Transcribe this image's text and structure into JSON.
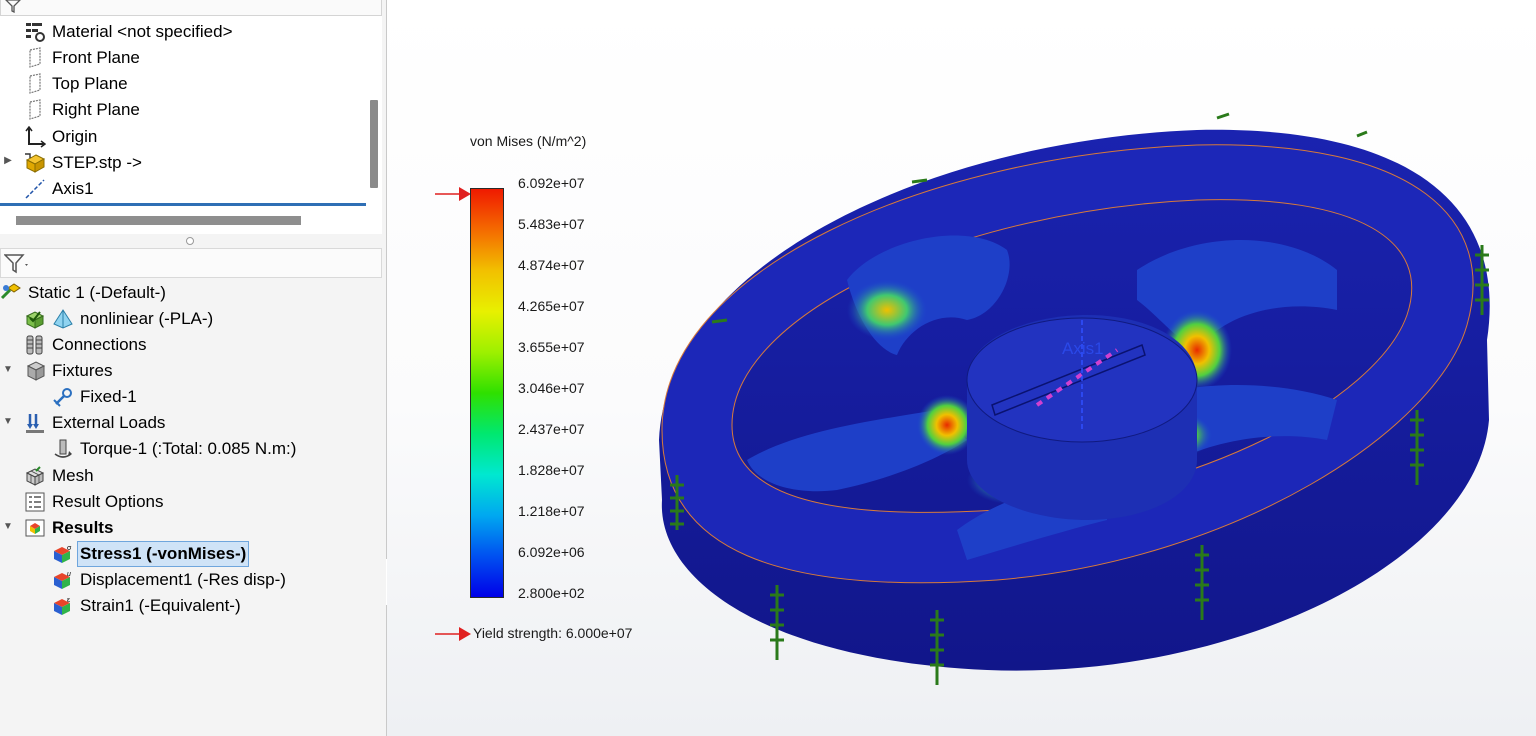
{
  "feature_tree": {
    "items": [
      {
        "label": "Material <not specified>",
        "icon": "material-icon"
      },
      {
        "label": "Front Plane",
        "icon": "plane-icon"
      },
      {
        "label": "Top Plane",
        "icon": "plane-icon"
      },
      {
        "label": "Right Plane",
        "icon": "plane-icon"
      },
      {
        "label": "Origin",
        "icon": "origin-icon"
      },
      {
        "label": "STEP.stp ->",
        "icon": "part-icon"
      },
      {
        "label": "Axis1",
        "icon": "axis-icon"
      }
    ]
  },
  "study_tree": {
    "study": {
      "label": "Static 1 (-Default-)",
      "icon": "study-icon"
    },
    "items": [
      {
        "label": "nonliniear (-PLA-)",
        "icon": "part-material-icon"
      },
      {
        "label": "Connections",
        "icon": "connections-icon"
      },
      {
        "label": "Fixtures",
        "icon": "fixtures-icon"
      },
      {
        "label": "Fixed-1",
        "icon": "fixed-icon"
      },
      {
        "label": "External Loads",
        "icon": "external-loads-icon"
      },
      {
        "label": "Torque-1 (:Total: 0.085 N.m:)",
        "icon": "torque-icon"
      },
      {
        "label": "Mesh",
        "icon": "mesh-icon"
      },
      {
        "label": "Result Options",
        "icon": "result-options-icon"
      },
      {
        "label": "Results",
        "icon": "results-icon"
      },
      {
        "label": "Stress1 (-vonMises-)",
        "icon": "stress-plot-icon"
      },
      {
        "label": "Displacement1 (-Res disp-)",
        "icon": "displacement-plot-icon"
      },
      {
        "label": "Strain1 (-Equivalent-)",
        "icon": "strain-plot-icon"
      }
    ]
  },
  "legend": {
    "title": "von Mises (N/m^2)",
    "ticks": [
      "6.092e+07",
      "5.483e+07",
      "4.874e+07",
      "4.265e+07",
      "3.655e+07",
      "3.046e+07",
      "2.437e+07",
      "1.828e+07",
      "1.218e+07",
      "6.092e+06",
      "2.800e+02"
    ],
    "yield_label": "Yield strength: 6.000e+07",
    "arrow_color": "#e02020"
  },
  "model": {
    "axis_label": "Axis1",
    "ring_color": "#1a1f9a",
    "fixture_color": "#3a9a2a"
  }
}
